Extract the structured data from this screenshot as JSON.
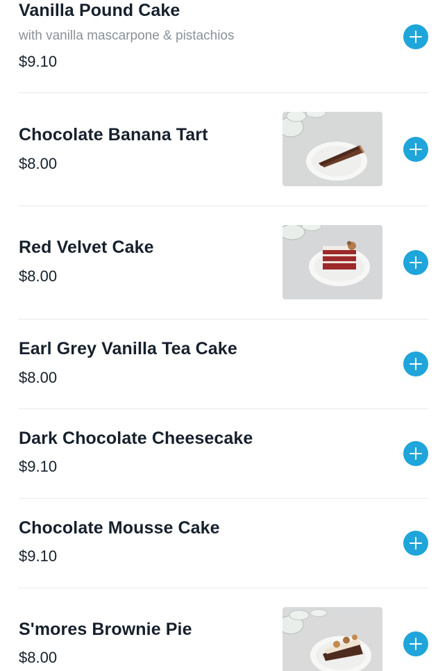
{
  "menu": {
    "items": [
      {
        "name": "Vanilla Pound Cake",
        "description": "with vanilla mascarpone & pistachios",
        "price": "$9.10",
        "has_photo": false,
        "photo_icon": "plate-icon",
        "add_icon": "plus-icon"
      },
      {
        "name": "Chocolate Banana Tart",
        "price": "$8.00",
        "has_photo": true,
        "photo_subject": "chocolate banana tart slice on white plate",
        "add_icon": "plus-icon"
      },
      {
        "name": "Red Velvet Cake",
        "price": "$8.00",
        "has_photo": true,
        "photo_subject": "red velvet cake slice on white plate",
        "add_icon": "plus-icon"
      },
      {
        "name": "Earl Grey Vanilla Tea Cake",
        "price": "$8.00",
        "has_photo": false,
        "add_icon": "plus-icon"
      },
      {
        "name": "Dark Chocolate Cheesecake",
        "price": "$9.10",
        "has_photo": false,
        "add_icon": "plus-icon"
      },
      {
        "name": "Chocolate Mousse Cake",
        "price": "$9.10",
        "has_photo": false,
        "add_icon": "plus-icon"
      },
      {
        "name": "S'mores Brownie Pie",
        "price": "$8.00",
        "has_photo": true,
        "photo_subject": "s'mores brownie pie slice on white plate",
        "add_icon": "plus-icon"
      }
    ]
  },
  "colors": {
    "accent": "#1fa5d9",
    "text": "#16202c",
    "muted_text": "#8a9197",
    "divider": "#e6e9ec"
  }
}
